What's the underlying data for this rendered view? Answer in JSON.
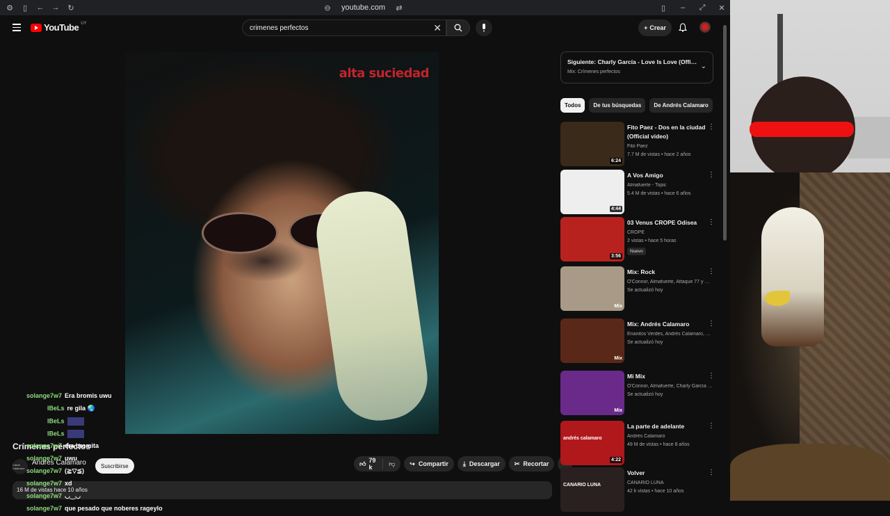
{
  "browser": {
    "url": "youtube.com"
  },
  "header": {
    "logo_text": "YouTube",
    "country": "UY",
    "search_value": "crimenes perfectos",
    "create_label": "Crear"
  },
  "video": {
    "cover_text": "alta suciedad",
    "title": "Crímenes perfectos",
    "channel": "Andrés Calamaro",
    "channel_avatar_text": "Canal Calamaro",
    "subscribe_label": "Suscribirse",
    "likes": "79 k",
    "share_label": "Compartir",
    "download_label": "Descargar",
    "clip_label": "Recortar",
    "description_meta": "16 M de vistas  hace 10 años"
  },
  "up_next": {
    "title": "Siguiente: Charly García - Love Is Love (Official Audi...",
    "subtitle": "Mix: Crímenes perfectos"
  },
  "chips": [
    "Todos",
    "De tus búsquedas",
    "De Andrés Calamaro"
  ],
  "recommendations": [
    {
      "title": "Fito Paez - Dos en la ciudad (Official video)",
      "channel": "Fito Paez",
      "meta": "7.7 M de vistas • hace 2 años",
      "duration": "6:24",
      "color": "#3a2a1a"
    },
    {
      "title": "A Vos Amigo",
      "channel": "Almafuerte - Topic",
      "meta": "5.4 M de vistas • hace 6 años",
      "duration": "4:44",
      "color": "#eeeeee"
    },
    {
      "title": "03  Venus CROPE Odisea",
      "channel": "CROPE",
      "meta": "2 vistas • hace 5 horas",
      "duration": "3:56",
      "badge": "Nuevo",
      "color": "#b8221e"
    },
    {
      "title": "Mix: Rock",
      "channel": "O'Connor, Almafuerte, Attaque 77 y muc...",
      "meta": "Se actualizó hoy",
      "duration": "Mix",
      "color": "#a89a86"
    },
    {
      "title": "Mix: Andrés Calamaro",
      "channel": "Enanitos Verdes, Andrés Calamaro, Rata ...",
      "meta": "Se actualizó hoy",
      "duration": "Mix",
      "color": "#5a2818"
    },
    {
      "title": "Mi Mix",
      "channel": "O'Connor, Almafuerte, Charly García y m...",
      "meta": "Se actualizó hoy",
      "duration": "Mix",
      "color": "#6a2a8a"
    },
    {
      "title": "La parte de adelante",
      "channel": "Andrés Calamaro",
      "meta": "49 M de vistas • hace 8 años",
      "duration": "4:22",
      "thumb_text": "andrés calamaro",
      "color": "#b0181c"
    },
    {
      "title": "Volver",
      "channel": "CANARIO LUNA",
      "meta": "42 k vistas • hace 10 años",
      "duration": "",
      "thumb_text": "CANARIO LUNA",
      "color": "#2a2020"
    }
  ],
  "chat": [
    {
      "user": "solange7w7",
      "msg": "Era bromis uwu"
    },
    {
      "user": "IBeLs",
      "msg": "re gila 🌏"
    },
    {
      "user": "IBeLs",
      "msg": ""
    },
    {
      "user": "IBeLs",
      "msg": ""
    },
    {
      "user": "solange7w7",
      "msg": "era bromita"
    },
    {
      "user": "solange7w7",
      "msg": "uwu"
    },
    {
      "user": "solange7w7",
      "msg": "(≧▽≦)"
    },
    {
      "user": "solange7w7",
      "msg": "xd"
    },
    {
      "user": "solange7w7",
      "msg": "◡‿◡"
    },
    {
      "user": "solange7w7",
      "msg": "que pesado que noberes rageylo"
    }
  ],
  "colors": {
    "accent": "#ff0000",
    "chat_user": "#8edc7e",
    "bg": "#0f0f0f"
  }
}
